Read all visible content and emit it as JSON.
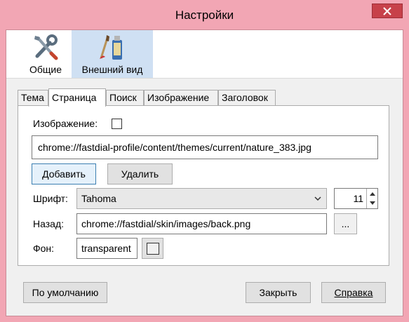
{
  "window": {
    "title": "Настройки"
  },
  "toolbar": {
    "items": [
      {
        "label": "Общие",
        "icon": "tools-icon"
      },
      {
        "label": "Внешний вид",
        "icon": "paint-brush-icon"
      }
    ]
  },
  "tabs": [
    "Тема",
    "Страница",
    "Поиск",
    "Изображение",
    "Заголовок"
  ],
  "active_tab": "Страница",
  "page": {
    "image_label": "Изображение:",
    "image_checked": false,
    "image_path": "chrome://fastdial-profile/content/themes/current/nature_383.jpg",
    "add_label": "Добавить",
    "remove_label": "Удалить",
    "font_label": "Шрифт:",
    "font_value": "Tahoma",
    "font_size": "11",
    "back_label": "Назад:",
    "back_path": "chrome://fastdial/skin/images/back.png",
    "browse_label": "...",
    "bg_label": "Фон:",
    "bg_value": "transparent"
  },
  "footer": {
    "defaults_label": "По умолчанию",
    "close_label": "Закрыть",
    "help_label": "Справка"
  },
  "colors": {
    "frame": "#f2a6b4",
    "close_button": "#c7414a",
    "selected_toolbar": "#cfe0f3",
    "focus_border": "#3c7fb1"
  }
}
